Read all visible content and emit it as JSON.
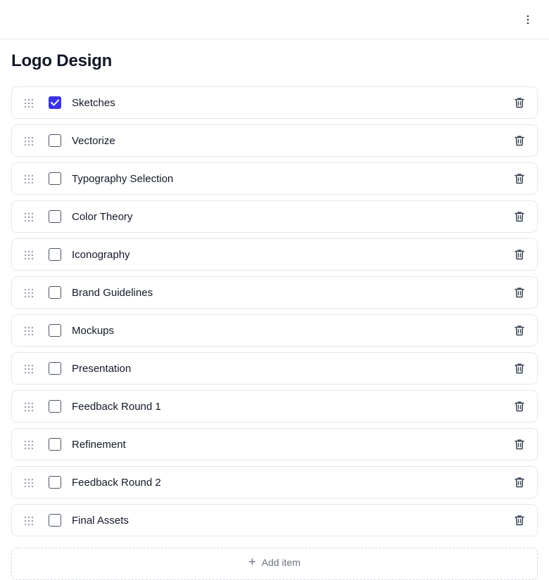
{
  "header": {
    "more_icon": "more-vertical-icon"
  },
  "page": {
    "title": "Logo Design"
  },
  "colors": {
    "accent": "#3b33e6",
    "border": "#e5e7eb",
    "text": "#111827",
    "muted": "#9ca3af"
  },
  "items": [
    {
      "label": "Sketches",
      "checked": true
    },
    {
      "label": "Vectorize",
      "checked": false
    },
    {
      "label": "Typography Selection",
      "checked": false
    },
    {
      "label": "Color Theory",
      "checked": false
    },
    {
      "label": "Iconography",
      "checked": false
    },
    {
      "label": "Brand Guidelines",
      "checked": false
    },
    {
      "label": "Mockups",
      "checked": false
    },
    {
      "label": "Presentation",
      "checked": false
    },
    {
      "label": "Feedback Round 1",
      "checked": false
    },
    {
      "label": "Refinement",
      "checked": false
    },
    {
      "label": "Feedback Round 2",
      "checked": false
    },
    {
      "label": "Final Assets",
      "checked": false
    }
  ],
  "add_item": {
    "label": "Add item"
  }
}
